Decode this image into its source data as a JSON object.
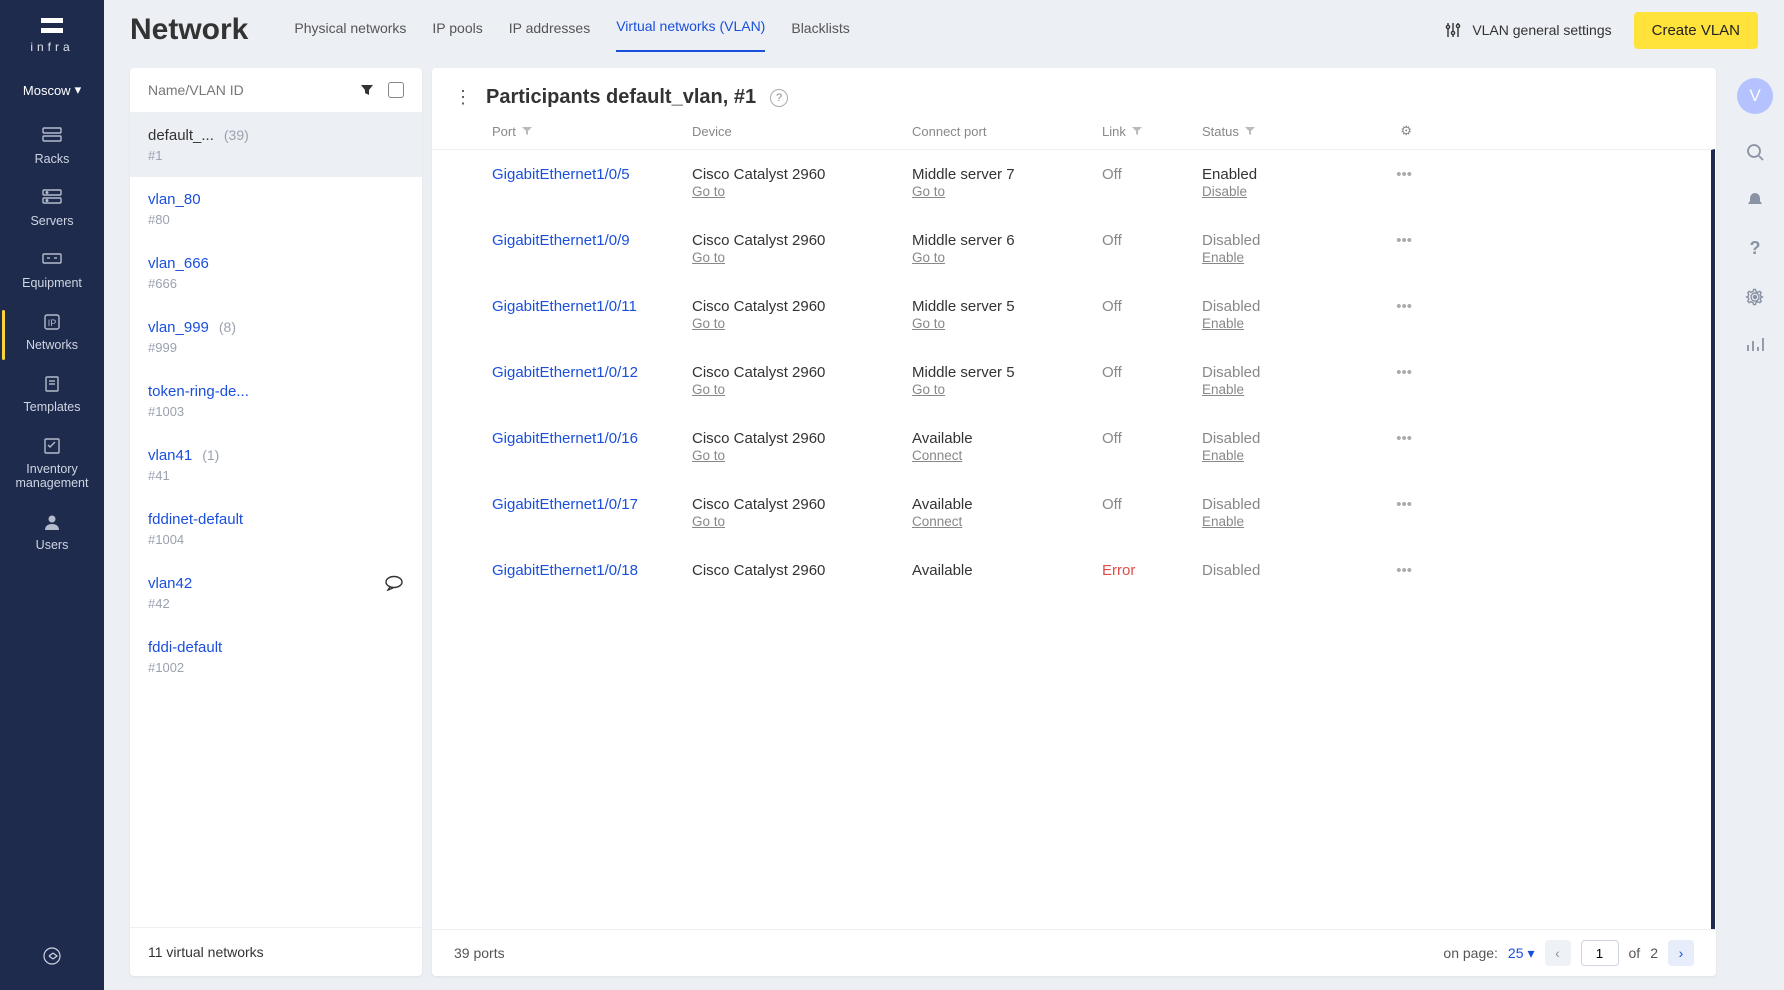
{
  "brand": "infra",
  "location": "Moscow",
  "rail": [
    {
      "key": "racks",
      "label": "Racks"
    },
    {
      "key": "servers",
      "label": "Servers"
    },
    {
      "key": "equipment",
      "label": "Equipment"
    },
    {
      "key": "networks",
      "label": "Networks"
    },
    {
      "key": "templates",
      "label": "Templates"
    },
    {
      "key": "inventory",
      "label": "Inventory management"
    },
    {
      "key": "users",
      "label": "Users"
    }
  ],
  "page_title": "Network",
  "tabs": [
    "Physical networks",
    "IP pools",
    "IP addresses",
    "Virtual networks (VLAN)",
    "Blacklists"
  ],
  "active_tab": 3,
  "settings_label": "VLAN general settings",
  "create_label": "Create VLAN",
  "avatar_letter": "V",
  "list_header": "Name/VLAN ID",
  "vlan_list": [
    {
      "name": "default_...",
      "count": "(39)",
      "sub": "#1",
      "selected": true
    },
    {
      "name": "vlan_80",
      "count": "",
      "sub": "#80"
    },
    {
      "name": "vlan_666",
      "count": "",
      "sub": "#666"
    },
    {
      "name": "vlan_999",
      "count": "(8)",
      "sub": "#999"
    },
    {
      "name": "token-ring-de...",
      "count": "",
      "sub": "#1003"
    },
    {
      "name": "vlan41",
      "count": "(1)",
      "sub": "#41"
    },
    {
      "name": "fddinet-default",
      "count": "",
      "sub": "#1004"
    },
    {
      "name": "vlan42",
      "count": "",
      "sub": "#42",
      "comment": true
    },
    {
      "name": "fddi-default",
      "count": "",
      "sub": "#1002"
    }
  ],
  "list_footer": "11 virtual networks",
  "detail_title": "Participants default_vlan, #1",
  "columns": [
    "Port",
    "Device",
    "Connect port",
    "Link",
    "Status",
    ""
  ],
  "rows": [
    {
      "port": "GigabitEthernet1/0/5",
      "device": "Cisco Catalyst 2960",
      "device_go": "Go to",
      "conn": "Middle server 7",
      "conn_go": "Go to",
      "link": "Off",
      "status": "Enabled",
      "status_mut": false,
      "action": "Disable"
    },
    {
      "port": "GigabitEthernet1/0/9",
      "device": "Cisco Catalyst 2960",
      "device_go": "Go to",
      "conn": "Middle server 6",
      "conn_go": "Go to",
      "link": "Off",
      "status": "Disabled",
      "status_mut": true,
      "action": "Enable"
    },
    {
      "port": "GigabitEthernet1/0/11",
      "device": "Cisco Catalyst 2960",
      "device_go": "Go to",
      "conn": "Middle server 5",
      "conn_go": "Go to",
      "link": "Off",
      "status": "Disabled",
      "status_mut": true,
      "action": "Enable"
    },
    {
      "port": "GigabitEthernet1/0/12",
      "device": "Cisco Catalyst 2960",
      "device_go": "Go to",
      "conn": "Middle server 5",
      "conn_go": "Go to",
      "link": "Off",
      "status": "Disabled",
      "status_mut": true,
      "action": "Enable"
    },
    {
      "port": "GigabitEthernet1/0/16",
      "device": "Cisco Catalyst 2960",
      "device_go": "Go to",
      "conn": "Available",
      "conn_go": "Connect",
      "link": "Off",
      "status": "Disabled",
      "status_mut": true,
      "action": "Enable"
    },
    {
      "port": "GigabitEthernet1/0/17",
      "device": "Cisco Catalyst 2960",
      "device_go": "Go to",
      "conn": "Available",
      "conn_go": "Connect",
      "link": "Off",
      "status": "Disabled",
      "status_mut": true,
      "action": "Enable"
    },
    {
      "port": "GigabitEthernet1/0/18",
      "device": "Cisco Catalyst 2960",
      "device_go": "",
      "conn": "Available",
      "conn_go": "",
      "link": "Error",
      "link_err": true,
      "status": "Disabled",
      "status_mut": true,
      "action": ""
    }
  ],
  "total_label": "39 ports",
  "pager": {
    "on_page": "on page:",
    "per_page": "25",
    "page": "1",
    "of": "of",
    "total": "2"
  }
}
